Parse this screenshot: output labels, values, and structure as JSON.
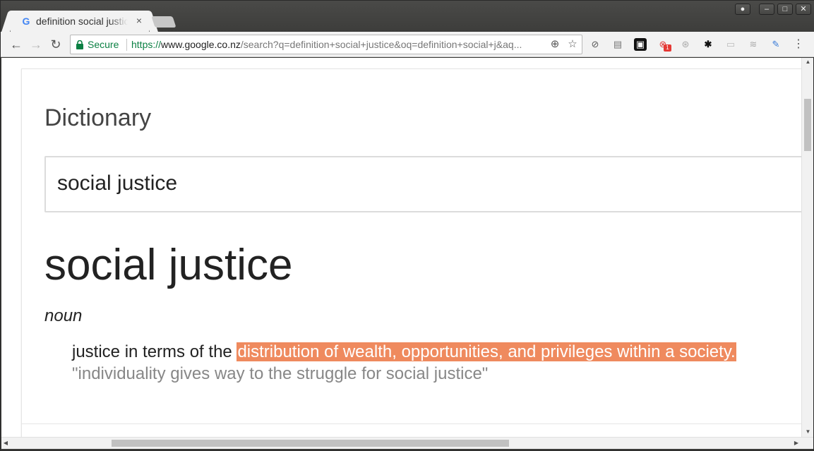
{
  "tab": {
    "favicon": "G",
    "title": "definition social justice",
    "close": "×"
  },
  "window_controls": {
    "profile": "●",
    "minimize": "–",
    "maximize": "□",
    "close": "✕"
  },
  "nav": {
    "back": "←",
    "forward": "→",
    "reload": "↻"
  },
  "omnibox": {
    "secure_label": "Secure",
    "url_scheme": "https://",
    "url_host": "www.google.co.nz",
    "url_path": "/search?q=definition+social+justice&oq=definition+social+j&aq...",
    "zoom_icon": "⊕",
    "star_icon": "☆"
  },
  "extensions": [
    {
      "name": "block-icon",
      "glyph": "⊘"
    },
    {
      "name": "page-icon",
      "glyph": "▤"
    },
    {
      "name": "lock-extension-icon",
      "glyph": "▣"
    },
    {
      "name": "privacy-extension-icon",
      "glyph": "⊗",
      "badge": "1"
    },
    {
      "name": "globe-icon",
      "glyph": "⊛"
    },
    {
      "name": "gnome-icon",
      "glyph": "✱"
    },
    {
      "name": "chat-icon",
      "glyph": "▭"
    },
    {
      "name": "rss-icon",
      "glyph": "≋"
    },
    {
      "name": "feather-icon",
      "glyph": "✎"
    },
    {
      "name": "menu-icon",
      "glyph": "⋮"
    }
  ],
  "dictionary": {
    "card_title": "Dictionary",
    "search_value": "social justice",
    "headword": "social justice",
    "part_of_speech": "noun",
    "definition_plain": "justice in terms of the ",
    "definition_highlighted": "distribution of wealth, opportunities, and privileges within a society.",
    "example": "\"individuality gives way to the struggle for social justice\""
  },
  "scrollbar": {
    "up_arrow": "▲",
    "down_arrow": "▼",
    "left_arrow": "◀",
    "right_arrow": "▶"
  },
  "colors": {
    "highlight": "#ef8a5e",
    "secure_green": "#0b8043",
    "example_gray": "#878787"
  }
}
